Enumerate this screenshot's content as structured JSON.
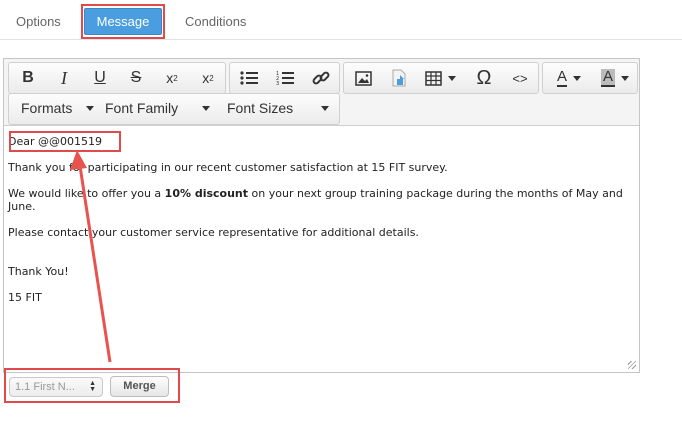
{
  "tabs": {
    "options": "Options",
    "message": "Message",
    "conditions": "Conditions"
  },
  "toolbar": {
    "formats": "Formats",
    "font_family": "Font Family",
    "font_sizes": "Font Sizes",
    "icons": [
      "bold-icon",
      "italic-icon",
      "underline-icon",
      "strikethrough-icon",
      "superscript-icon",
      "subscript-icon",
      "bullet-list-icon",
      "numbered-list-icon",
      "link-icon",
      "image-icon",
      "insert-file-icon",
      "table-icon",
      "omega-icon",
      "code-icon",
      "text-color-icon",
      "background-color-icon"
    ]
  },
  "content": {
    "greeting": "Dear @@001519",
    "line1": "Thank you for participating in our recent customer satisfaction at 15 FIT survey.",
    "line2_pre": "We would like to offer you a ",
    "line2_bold": "10% discount",
    "line2_post": " on your next group training package during the months of May and June.",
    "line3": "Please contact your customer service representative for additional details.",
    "closing": "Thank You!",
    "signature": "15 FIT"
  },
  "merge": {
    "selected_field": "1.1 First N...",
    "button_label": "Merge"
  },
  "colors": {
    "tab_active": "#4a9ee0",
    "highlight": "#e14a4a"
  }
}
